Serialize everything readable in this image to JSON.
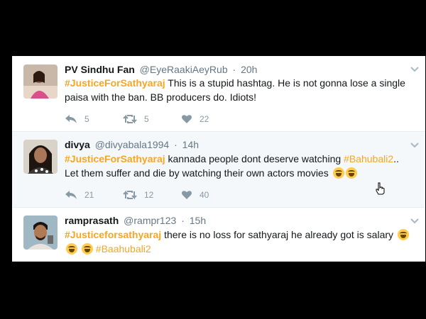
{
  "tweets": [
    {
      "name": "PV Sindhu Fan",
      "handle": "@EyeRaakiAeyRub",
      "sep": "·",
      "time": "20h",
      "hashtag": "#JusticeForSathyaraj",
      "text": "This is a stupid hashtag. He is not gonna lose a single paisa with the ban. BB producers do. Idiots!",
      "replies": "5",
      "retweets": "5",
      "likes": "22"
    },
    {
      "name": "divya",
      "handle": "@divyabala1994",
      "sep": "·",
      "time": "14h",
      "hashtag": "#JusticeForSathyaraj",
      "text_part1": "kannada people dont deserve watching",
      "hashtag2": "#Bahubali2",
      "text_part2": ".. Let them suffer and die by watching their own actors movies",
      "replies": "21",
      "retweets": "12",
      "likes": "40"
    },
    {
      "name": "ramprasath",
      "handle": "@rampr123",
      "sep": "·",
      "time": "15h",
      "hashtag": "#Justiceforsathyaraj",
      "text": "there is no loss for sathyaraj he already got is salary",
      "hashtag2": "#Baahubali2"
    }
  ],
  "icons": {
    "reply": "reply-icon",
    "retweet": "retweet-icon",
    "like": "heart-icon",
    "more": "chevron-down-icon",
    "emoji": "face-with-tears-of-joy"
  },
  "colors": {
    "hashtag": "#f5a623",
    "action_gray": "#8899a6",
    "alt_row": "#f5f8fa"
  }
}
